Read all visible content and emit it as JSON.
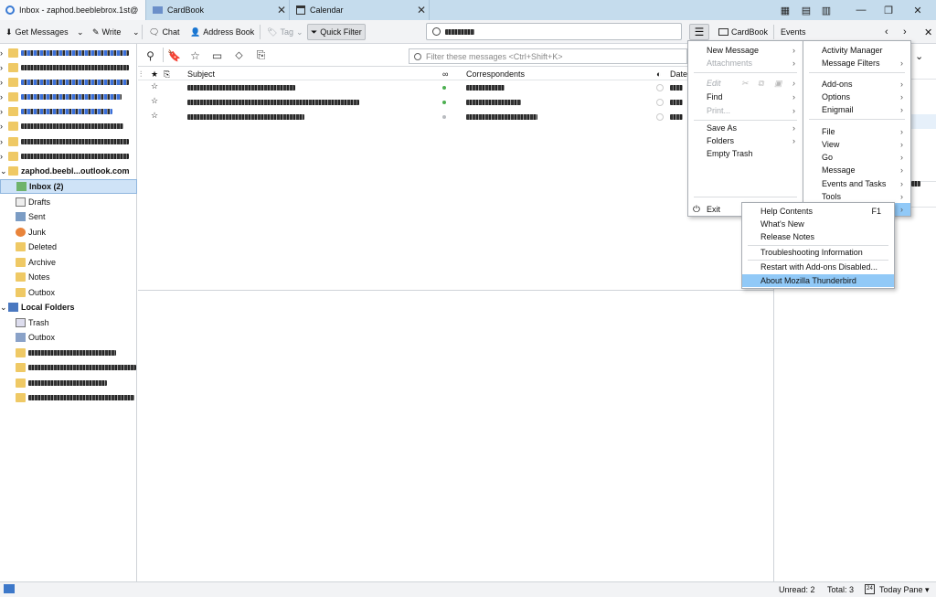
{
  "tabs": [
    {
      "label": "Inbox - zaphod.beeblebrox.1st@"
    },
    {
      "label": "CardBook"
    },
    {
      "label": "Calendar"
    }
  ],
  "toolbar": {
    "get_messages": "Get Messages",
    "write": "Write",
    "chat": "Chat",
    "address_book": "Address Book",
    "tag": "Tag",
    "quick_filter": "Quick Filter",
    "cardbook": "CardBook",
    "events": "Events"
  },
  "folders": {
    "account": "zaphod.beebl...outlook.com",
    "inbox": "Inbox (2)",
    "drafts": "Drafts",
    "sent": "Sent",
    "junk": "Junk",
    "deleted": "Deleted",
    "archive": "Archive",
    "notes": "Notes",
    "outbox": "Outbox",
    "local": "Local Folders",
    "trash": "Trash",
    "local_outbox": "Outbox"
  },
  "messages": {
    "filter_placeholder": "Filter these messages <Ctrl+Shift+K>",
    "col_subject": "Subject",
    "col_correspondents": "Correspondents",
    "col_date": "Date"
  },
  "app_menu": {
    "new_message": "New Message",
    "attachments": "Attachments",
    "edit": "Edit",
    "find": "Find",
    "print": "Print...",
    "save_as": "Save As",
    "folders": "Folders",
    "empty_trash": "Empty Trash",
    "exit": "Exit"
  },
  "side_menu": {
    "activity_manager": "Activity Manager",
    "message_filters": "Message Filters",
    "add_ons": "Add-ons",
    "options": "Options",
    "enigmail": "Enigmail",
    "file": "File",
    "view": "View",
    "go": "Go",
    "message": "Message",
    "events_tasks": "Events and Tasks",
    "tools": "Tools"
  },
  "help_menu": {
    "help_contents": "Help Contents",
    "help_shortcut": "F1",
    "whats_new": "What's New",
    "release_notes": "Release Notes",
    "troubleshooting": "Troubleshooting Information",
    "restart": "Restart with Add-ons Disabled...",
    "about": "About Mozilla Thunderbird"
  },
  "status": {
    "unread": "Unread: 2",
    "total": "Total: 3",
    "today_pane": "Today Pane"
  },
  "colors": {
    "tabbar": "#c5dced",
    "selection": "#cfe3f7",
    "menu_highlight": "#91c9f7",
    "folder": "#efc965"
  }
}
